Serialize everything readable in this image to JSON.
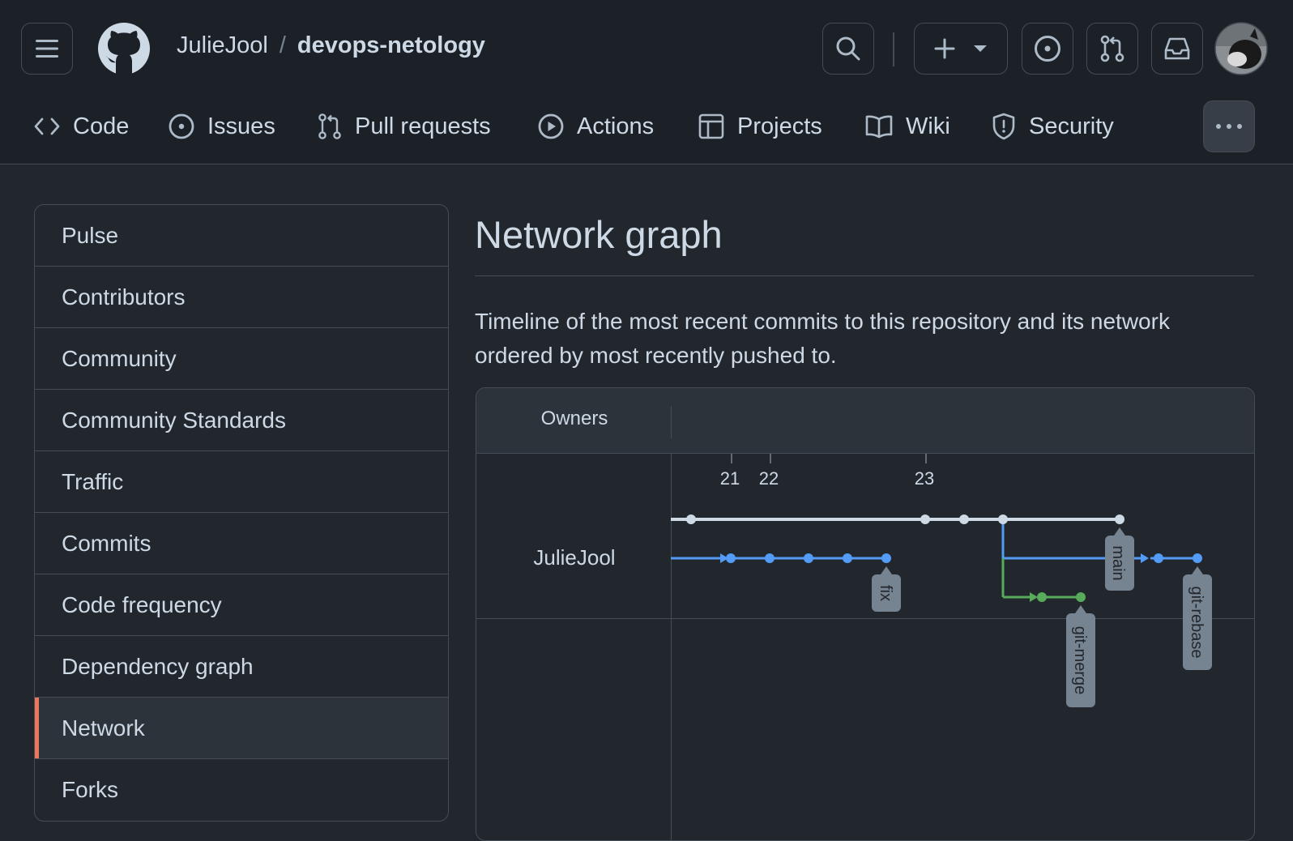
{
  "header": {
    "owner": "JulieJool",
    "separator": "/",
    "repo": "devops-netology"
  },
  "repo_nav": {
    "tabs": [
      {
        "label": "Code",
        "icon": "code-icon"
      },
      {
        "label": "Issues",
        "icon": "issue-icon"
      },
      {
        "label": "Pull requests",
        "icon": "pull-request-icon"
      },
      {
        "label": "Actions",
        "icon": "play-icon"
      },
      {
        "label": "Projects",
        "icon": "table-icon"
      },
      {
        "label": "Wiki",
        "icon": "book-icon"
      },
      {
        "label": "Security",
        "icon": "shield-icon"
      }
    ],
    "more_icon": "kebab-horizontal-icon"
  },
  "sidebar": {
    "items": [
      {
        "label": "Pulse"
      },
      {
        "label": "Contributors"
      },
      {
        "label": "Community"
      },
      {
        "label": "Community Standards"
      },
      {
        "label": "Traffic"
      },
      {
        "label": "Commits"
      },
      {
        "label": "Code frequency"
      },
      {
        "label": "Dependency graph"
      },
      {
        "label": "Network",
        "selected": true
      },
      {
        "label": "Forks"
      }
    ]
  },
  "main": {
    "title": "Network graph",
    "description": "Timeline of the most recent commits to this repository and its network ordered by most recently pushed to."
  },
  "network": {
    "owners_header": "Owners",
    "owner": "JulieJool",
    "dates": [
      "21",
      "22",
      "23"
    ],
    "branches": [
      {
        "name": "main",
        "color": "#cdd9e5"
      },
      {
        "name": "fix",
        "color": "#539bf5"
      },
      {
        "name": "git-merge",
        "color": "#57ab5a"
      },
      {
        "name": "git-rebase",
        "color": "#539bf5"
      }
    ]
  },
  "colors": {
    "background": "#22272e",
    "header_background": "#1c2128",
    "border": "#444c56",
    "selected_indicator": "#ec775c",
    "text": "#cdd9e5"
  }
}
